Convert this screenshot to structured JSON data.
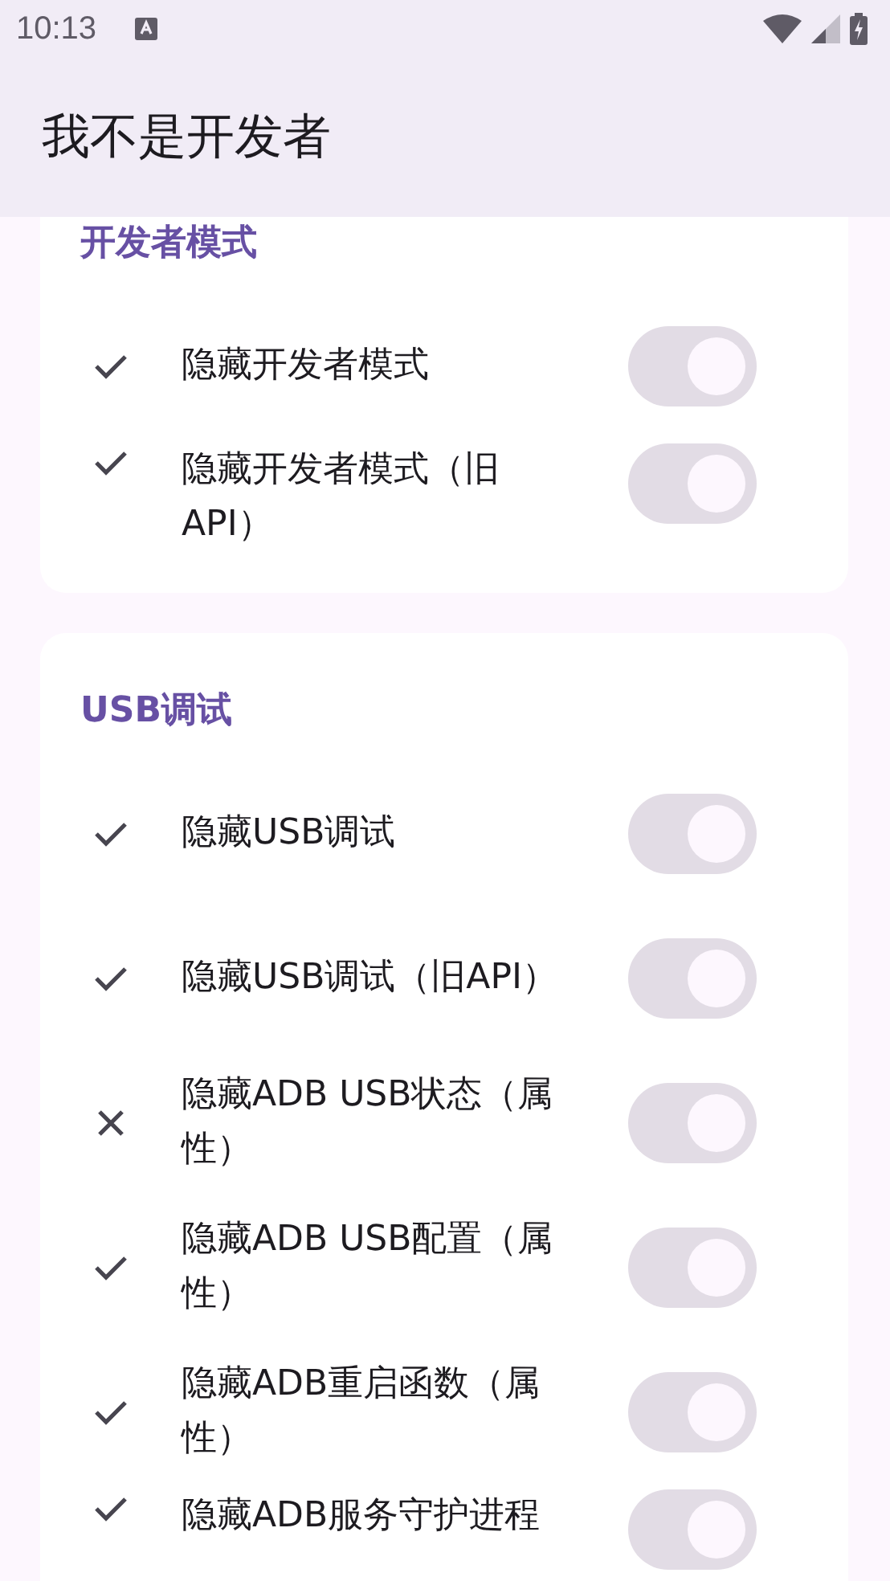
{
  "status_bar": {
    "time": "10:13"
  },
  "app_bar": {
    "title": "我不是开发者"
  },
  "sections": [
    {
      "title": "开发者模式",
      "cut_top": true,
      "items": [
        {
          "label": "隐藏开发者模式",
          "passed": true,
          "on": true,
          "disabled": true
        },
        {
          "label": "隐藏开发者模式（旧API）",
          "passed": true,
          "on": true,
          "disabled": true
        }
      ]
    },
    {
      "title": "USB调试",
      "cut_top": false,
      "items": [
        {
          "label": "隐藏USB调试",
          "passed": true,
          "on": true,
          "disabled": true
        },
        {
          "label": "隐藏USB调试（旧API）",
          "passed": true,
          "on": true,
          "disabled": true
        },
        {
          "label": "隐藏ADB USB状态（属性）",
          "passed": false,
          "on": true,
          "disabled": true
        },
        {
          "label": "隐藏ADB USB配置（属性）",
          "passed": true,
          "on": true,
          "disabled": true
        },
        {
          "label": "隐藏ADB重启函数（属性）",
          "passed": true,
          "on": true,
          "disabled": true
        },
        {
          "label": "隐藏ADB服务守护进程",
          "passed": true,
          "on": true,
          "disabled": true
        }
      ]
    }
  ]
}
